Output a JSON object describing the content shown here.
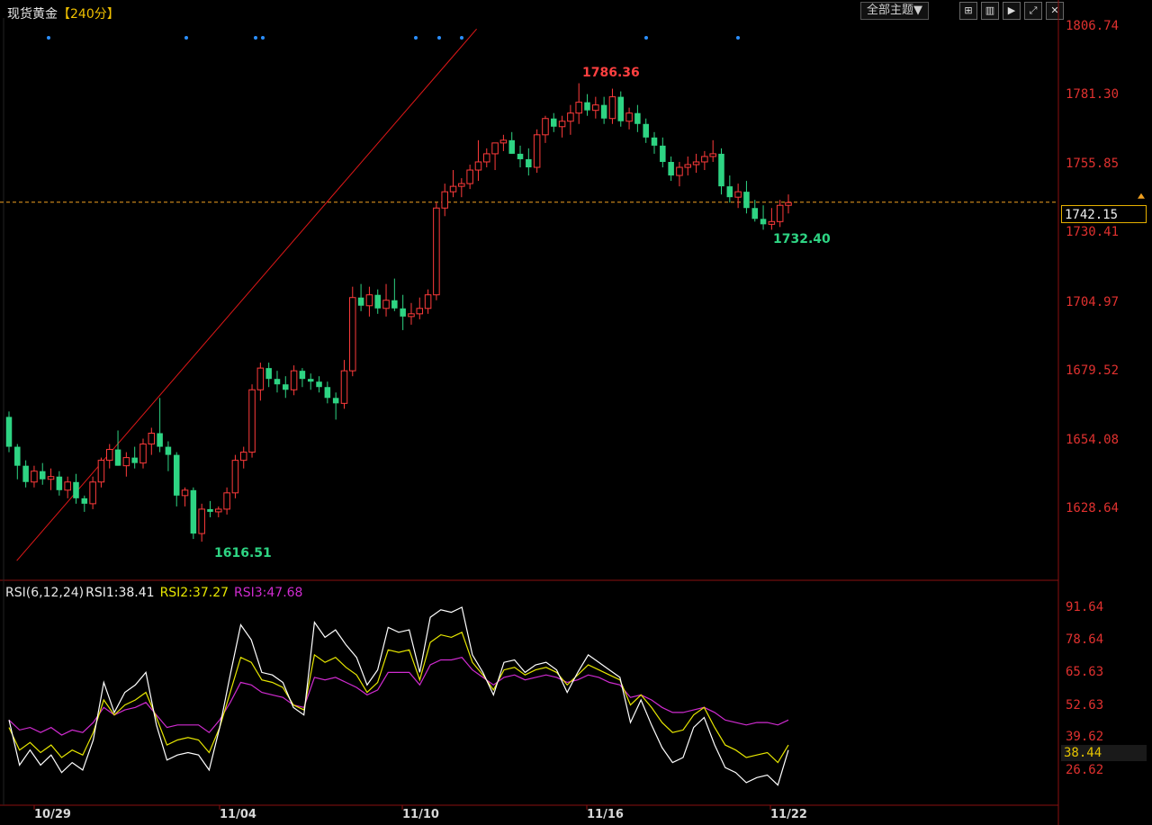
{
  "header": {
    "symbol": "现货黄金",
    "period": "【240分】",
    "theme_button": "全部主题▼",
    "icon_buttons": [
      "grid-icon",
      "layout-icon",
      "play-icon",
      "expand-icon",
      "close-window-icon"
    ]
  },
  "price_axis": {
    "ticks": [
      "1806.74",
      "1781.30",
      "1755.85",
      "1730.41",
      "1704.97",
      "1679.52",
      "1654.08",
      "1628.64"
    ],
    "current_price": "1742.15"
  },
  "annotations": {
    "high": "1786.36",
    "recent_low": "1732.40",
    "low": "1616.51"
  },
  "rsi": {
    "title": "RSI(6,12,24)",
    "rsi1": "RSI1:38.41",
    "rsi2": "RSI2:37.27",
    "rsi3": "RSI3:47.68",
    "ticks": [
      "91.64",
      "78.64",
      "65.63",
      "52.63",
      "39.62",
      "26.62"
    ],
    "current": "38.44"
  },
  "x_axis": {
    "dates": [
      "10/29",
      "11/04",
      "11/10",
      "11/16",
      "11/22"
    ]
  },
  "colors": {
    "up": "#ff3b3b",
    "down": "#2ed483",
    "rsi1": "#ffffff",
    "rsi2": "#e6e600",
    "rsi3": "#d02bd0",
    "current_line": "#f0a020",
    "trend": "#e01818"
  },
  "chart_data": {
    "type": "candlestick",
    "title": "现货黄金【240分】",
    "ylim": [
      1605,
      1812
    ],
    "candles": [
      [
        1663,
        1665,
        1650,
        1652
      ],
      [
        1652,
        1653,
        1640,
        1645
      ],
      [
        1645,
        1647,
        1637,
        1639
      ],
      [
        1639,
        1645,
        1637,
        1643
      ],
      [
        1643,
        1646,
        1638,
        1640
      ],
      [
        1640,
        1644,
        1636,
        1641
      ],
      [
        1641,
        1643,
        1634,
        1636
      ],
      [
        1636,
        1641,
        1633,
        1639
      ],
      [
        1639,
        1642,
        1631,
        1633
      ],
      [
        1633,
        1634,
        1628,
        1631
      ],
      [
        1631,
        1641,
        1629,
        1639
      ],
      [
        1639,
        1648,
        1637,
        1647
      ],
      [
        1647,
        1653,
        1644,
        1651
      ],
      [
        1651,
        1658,
        1645,
        1645
      ],
      [
        1645,
        1650,
        1641,
        1648
      ],
      [
        1648,
        1652,
        1644,
        1646
      ],
      [
        1646,
        1655,
        1644,
        1653
      ],
      [
        1653,
        1659,
        1649,
        1657
      ],
      [
        1657,
        1670,
        1650,
        1652
      ],
      [
        1652,
        1654,
        1643,
        1649
      ],
      [
        1649,
        1650,
        1630,
        1634
      ],
      [
        1634,
        1637,
        1630,
        1636
      ],
      [
        1636,
        1637,
        1618,
        1620
      ],
      [
        1620,
        1631,
        1617,
        1629
      ],
      [
        1629,
        1632,
        1626,
        1628
      ],
      [
        1628,
        1630,
        1626,
        1629
      ],
      [
        1629,
        1637,
        1627,
        1635
      ],
      [
        1635,
        1649,
        1633,
        1647
      ],
      [
        1647,
        1652,
        1644,
        1650
      ],
      [
        1650,
        1675,
        1648,
        1673
      ],
      [
        1673,
        1683,
        1669,
        1681
      ],
      [
        1681,
        1683,
        1674,
        1677
      ],
      [
        1677,
        1680,
        1672,
        1675
      ],
      [
        1675,
        1678,
        1670,
        1673
      ],
      [
        1673,
        1682,
        1671,
        1680
      ],
      [
        1680,
        1681,
        1674,
        1677
      ],
      [
        1677,
        1679,
        1673,
        1676
      ],
      [
        1676,
        1678,
        1672,
        1674
      ],
      [
        1674,
        1676,
        1668,
        1670
      ],
      [
        1670,
        1672,
        1662,
        1668
      ],
      [
        1668,
        1684,
        1666,
        1680
      ],
      [
        1680,
        1711,
        1678,
        1707
      ],
      [
        1707,
        1712,
        1702,
        1704
      ],
      [
        1704,
        1711,
        1700,
        1708
      ],
      [
        1708,
        1710,
        1701,
        1703
      ],
      [
        1703,
        1712,
        1700,
        1706
      ],
      [
        1706,
        1714,
        1702,
        1703
      ],
      [
        1703,
        1708,
        1695,
        1700
      ],
      [
        1700,
        1705,
        1697,
        1701
      ],
      [
        1701,
        1707,
        1699,
        1703
      ],
      [
        1703,
        1710,
        1701,
        1708
      ],
      [
        1708,
        1742,
        1706,
        1740
      ],
      [
        1740,
        1749,
        1737,
        1746
      ],
      [
        1746,
        1754,
        1744,
        1748
      ],
      [
        1748,
        1751,
        1744,
        1749
      ],
      [
        1749,
        1756,
        1747,
        1754
      ],
      [
        1754,
        1765,
        1750,
        1757
      ],
      [
        1757,
        1762,
        1755,
        1760
      ],
      [
        1760,
        1763,
        1754,
        1764
      ],
      [
        1764,
        1767,
        1761,
        1765
      ],
      [
        1765,
        1768,
        1760,
        1760
      ],
      [
        1760,
        1763,
        1755,
        1758
      ],
      [
        1758,
        1762,
        1752,
        1755
      ],
      [
        1755,
        1769,
        1753,
        1767
      ],
      [
        1767,
        1774,
        1764,
        1773
      ],
      [
        1773,
        1775,
        1768,
        1770
      ],
      [
        1770,
        1774,
        1766,
        1772
      ],
      [
        1772,
        1778,
        1767,
        1775
      ],
      [
        1775,
        1786,
        1771,
        1779
      ],
      [
        1779,
        1782,
        1774,
        1776
      ],
      [
        1776,
        1781,
        1773,
        1778
      ],
      [
        1778,
        1781,
        1771,
        1773
      ],
      [
        1773,
        1784,
        1771,
        1781
      ],
      [
        1781,
        1783,
        1770,
        1772
      ],
      [
        1772,
        1777,
        1769,
        1775
      ],
      [
        1775,
        1778,
        1768,
        1771
      ],
      [
        1771,
        1773,
        1764,
        1766
      ],
      [
        1766,
        1768,
        1760,
        1763
      ],
      [
        1763,
        1766,
        1755,
        1757
      ],
      [
        1757,
        1759,
        1750,
        1752
      ],
      [
        1752,
        1757,
        1748,
        1755
      ],
      [
        1755,
        1759,
        1752,
        1756
      ],
      [
        1756,
        1760,
        1753,
        1757
      ],
      [
        1757,
        1761,
        1754,
        1759
      ],
      [
        1759,
        1765,
        1757,
        1760
      ],
      [
        1760,
        1762,
        1745,
        1748
      ],
      [
        1748,
        1752,
        1742,
        1744
      ],
      [
        1744,
        1749,
        1740,
        1746
      ],
      [
        1746,
        1750,
        1738,
        1740
      ],
      [
        1740,
        1743,
        1735,
        1736
      ],
      [
        1736,
        1741,
        1732,
        1734
      ],
      [
        1734,
        1740,
        1732,
        1735
      ],
      [
        1735,
        1743,
        1733,
        1741
      ],
      [
        1741,
        1745,
        1738,
        1742
      ]
    ],
    "trendline": [
      [
        0.01,
        1610
      ],
      [
        0.6,
        1806
      ]
    ],
    "rsi1": [
      47,
      29,
      35,
      29,
      33,
      26,
      30,
      27,
      39,
      62,
      50,
      58,
      61,
      66,
      45,
      31,
      33,
      34,
      33,
      27,
      44,
      65,
      85,
      79,
      66,
      65,
      62,
      52,
      49,
      86,
      80,
      83,
      77,
      72,
      61,
      67,
      84,
      82,
      83,
      66,
      88,
      91,
      90,
      92,
      73,
      66,
      57,
      70,
      71,
      66,
      69,
      70,
      67,
      58,
      66,
      73,
      70,
      67,
      64,
      46,
      55,
      45,
      36,
      30,
      32,
      44,
      48,
      37,
      28,
      26,
      22,
      24,
      25,
      21,
      35
    ],
    "rsi2": [
      44,
      35,
      38,
      34,
      37,
      32,
      35,
      33,
      42,
      55,
      49,
      53,
      55,
      58,
      48,
      37,
      39,
      40,
      39,
      34,
      44,
      58,
      72,
      70,
      63,
      62,
      60,
      53,
      51,
      73,
      70,
      72,
      68,
      65,
      58,
      62,
      75,
      74,
      75,
      63,
      78,
      81,
      80,
      82,
      70,
      65,
      59,
      67,
      68,
      65,
      67,
      68,
      66,
      61,
      65,
      69,
      67,
      65,
      63,
      53,
      57,
      52,
      46,
      42,
      43,
      49,
      52,
      44,
      37,
      35,
      32,
      33,
      34,
      30,
      37
    ],
    "rsi3": [
      47,
      43,
      44,
      42,
      44,
      41,
      43,
      42,
      46,
      52,
      49,
      51,
      52,
      54,
      49,
      44,
      45,
      45,
      45,
      42,
      47,
      54,
      62,
      61,
      58,
      57,
      56,
      53,
      52,
      64,
      63,
      64,
      62,
      60,
      57,
      59,
      66,
      66,
      66,
      61,
      69,
      71,
      71,
      72,
      67,
      64,
      61,
      64,
      65,
      63,
      64,
      65,
      64,
      62,
      63,
      65,
      64,
      62,
      61,
      56,
      57,
      55,
      52,
      50,
      50,
      51,
      52,
      50,
      47,
      46,
      45,
      46,
      46,
      45,
      47
    ]
  }
}
